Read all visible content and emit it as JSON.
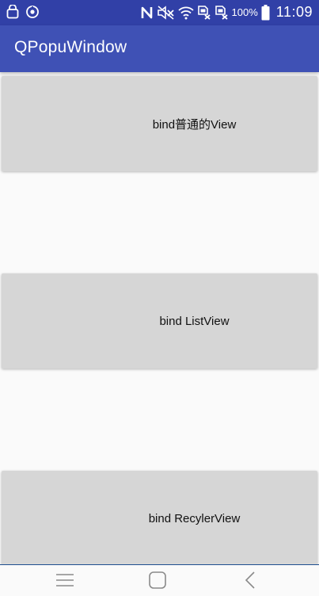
{
  "status_bar": {
    "battery_percent": "100%",
    "time": "11:09",
    "left_icons": [
      "bag-icon",
      "sync-icon"
    ],
    "right_icons": [
      "nfc-icon",
      "mute-icon",
      "wifi-icon",
      "no-sim-icon",
      "no-sim-icon",
      "battery-icon"
    ]
  },
  "app_bar": {
    "title": "QPopuWindow",
    "color": "#3f51b5"
  },
  "buttons": [
    {
      "label": "bind普通的View"
    },
    {
      "label": "bind ListView"
    },
    {
      "label": "bind RecylerView"
    }
  ],
  "nav_bar": {
    "icons": [
      "menu-icon",
      "home-icon",
      "back-icon"
    ]
  }
}
